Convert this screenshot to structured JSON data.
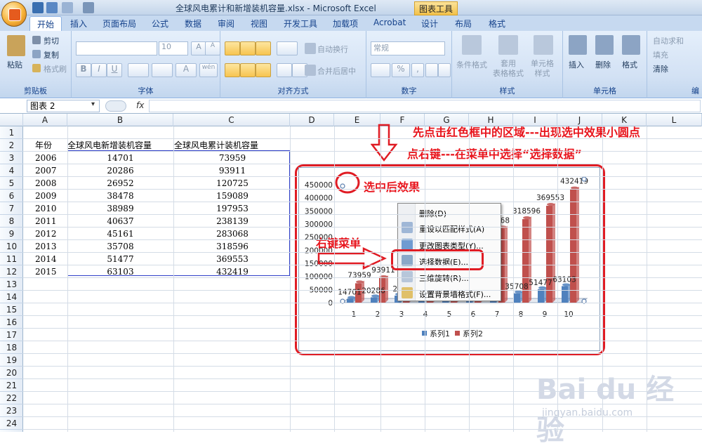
{
  "window": {
    "title": "全球风电累计和新增装机容量.xlsx - Microsoft Excel",
    "context_tab_group": "图表工具"
  },
  "tabs": [
    "开始",
    "插入",
    "页面布局",
    "公式",
    "数据",
    "审阅",
    "视图",
    "开发工具",
    "加载项",
    "Acrobat",
    "设计",
    "布局",
    "格式"
  ],
  "ribbon": {
    "clipboard": {
      "paste": "粘贴",
      "cut": "剪切",
      "copy": "复制",
      "format_painter": "格式刷",
      "label": "剪贴板"
    },
    "font": {
      "size": "10",
      "label": "字体",
      "bold": "B",
      "italic": "I",
      "underline": "U",
      "grow": "A",
      "shrink": "A",
      "color": "A",
      "wen": "wén"
    },
    "alignment": {
      "wrap": "自动换行",
      "merge": "合并后居中",
      "label": "对齐方式"
    },
    "number": {
      "format": "常规",
      "percent": "%",
      "comma": ",",
      "inc": ".0→.00",
      "dec": ".00→.0",
      "label": "数字"
    },
    "styles": {
      "conditional": "条件格式",
      "table": "套用\n表格格式",
      "cell": "单元格\n样式",
      "label": "样式"
    },
    "cells": {
      "insert": "插入",
      "delete": "删除",
      "format": "格式",
      "label": "单元格"
    },
    "editing": {
      "autosum": "自动求和",
      "fill": "填充",
      "clear": "清除",
      "label": "编"
    }
  },
  "formula_bar": {
    "name_box": "图表 2",
    "fx": "fx"
  },
  "columns": [
    "A",
    "B",
    "C",
    "D",
    "E",
    "F",
    "G",
    "H",
    "I",
    "J",
    "K",
    "L"
  ],
  "rows": [
    "1",
    "2",
    "3",
    "4",
    "5",
    "6",
    "7",
    "8",
    "9",
    "10",
    "11",
    "12",
    "13",
    "14",
    "15",
    "16",
    "17",
    "18",
    "19",
    "20",
    "21",
    "22",
    "23",
    "24"
  ],
  "sheet": {
    "headers": {
      "year": "年份",
      "new": "全球风电新增装机容量",
      "total": "全球风电累计装机容量"
    },
    "data": [
      {
        "year": "2006",
        "new": "14701",
        "total": "73959"
      },
      {
        "year": "2007",
        "new": "20286",
        "total": "93911"
      },
      {
        "year": "2008",
        "new": "26952",
        "total": "120725"
      },
      {
        "year": "2009",
        "new": "38478",
        "total": "159089"
      },
      {
        "year": "2010",
        "new": "38989",
        "total": "197953"
      },
      {
        "year": "2011",
        "new": "40637",
        "total": "238139"
      },
      {
        "year": "2012",
        "new": "45161",
        "total": "283068"
      },
      {
        "year": "2013",
        "new": "35708",
        "total": "318596"
      },
      {
        "year": "2014",
        "new": "51477",
        "total": "369553"
      },
      {
        "year": "2015",
        "new": "63103",
        "total": "432419"
      }
    ]
  },
  "annotations": {
    "instruction_line1": "先点击红色框中的区域---出现选中效果小圆点",
    "instruction_line2": "点右键---在菜单中选择“选择数据”",
    "selected_effect": "选中后效果",
    "right_click_menu": "右键菜单"
  },
  "context_menu": {
    "items": [
      "删除(D)",
      "重设以匹配样式(A)",
      "更改图表类型(Y)...",
      "选择数据(E)...",
      "三维旋转(R)...",
      "设置背景墙格式(F)..."
    ]
  },
  "watermark": {
    "brand": "Bai du 经验",
    "url": "jingyan.baidu.com"
  },
  "chart_data": {
    "type": "bar",
    "categories": [
      "1",
      "2",
      "3",
      "4",
      "5",
      "6",
      "7",
      "8",
      "9",
      "10"
    ],
    "series": [
      {
        "name": "系列1",
        "values": [
          14701,
          20286,
          26952,
          38478,
          38989,
          40637,
          45161,
          35708,
          51477,
          63103
        ],
        "color": "#4f81bd"
      },
      {
        "name": "系列2",
        "values": [
          73959,
          93911,
          120725,
          159089,
          197953,
          238139,
          283068,
          318596,
          369553,
          432419
        ],
        "color": "#c0504d"
      }
    ],
    "ylim": [
      0,
      450000
    ],
    "yticks": [
      "0",
      "50000",
      "100000",
      "150000",
      "200000",
      "250000",
      "300000",
      "350000",
      "400000",
      "450000"
    ],
    "data_labels": {
      "s1": [
        "14701",
        "20286",
        "26",
        "",
        "",
        "",
        "",
        "35708",
        "51477",
        "63103"
      ],
      "s2": [
        "73959",
        "93911",
        "1",
        "",
        "",
        "",
        "068",
        "318596",
        "369553",
        "432419"
      ]
    },
    "legend_position": "bottom",
    "grid": false
  }
}
